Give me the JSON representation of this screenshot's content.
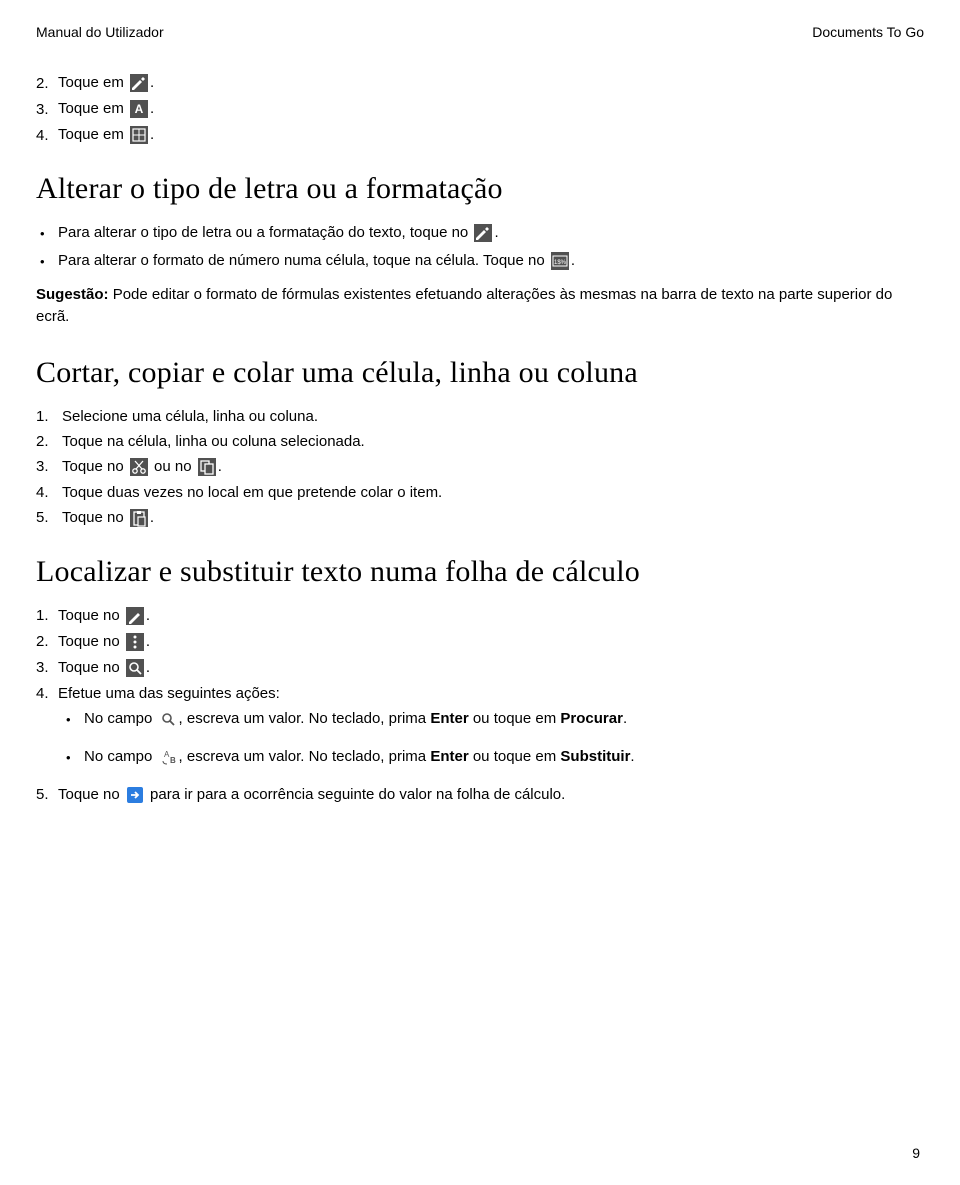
{
  "header": {
    "left": "Manual do Utilizador",
    "right": "Documents To Go"
  },
  "intro_list": [
    {
      "n": "2.",
      "pre": "Toque em ",
      "icon": "pen-icon",
      "post": "."
    },
    {
      "n": "3.",
      "pre": "Toque em ",
      "icon": "a-icon",
      "post": "."
    },
    {
      "n": "4.",
      "pre": "Toque em ",
      "icon": "grid-icon",
      "post": "."
    }
  ],
  "section1": {
    "title": "Alterar o tipo de letra ou a formatação",
    "bullets": [
      {
        "pre": "Para alterar o tipo de letra ou a formatação do texto, toque no ",
        "icon": "pen-icon",
        "post": "."
      },
      {
        "pre": "Para alterar o formato de número numa célula, toque na célula. Toque no ",
        "icon": "numfmt-icon",
        "post": "."
      }
    ],
    "suggestion_label": "Sugestão: ",
    "suggestion_text": "Pode editar o formato de fórmulas existentes efetuando alterações às mesmas na barra de texto na parte superior do ecrã."
  },
  "section2": {
    "title": "Cortar, copiar e colar uma célula, linha ou coluna",
    "items": [
      {
        "n": "1.",
        "full": "Selecione uma célula, linha ou coluna."
      },
      {
        "n": "2.",
        "full": "Toque na célula, linha ou coluna selecionada."
      },
      {
        "n": "3.",
        "pre": "Toque no ",
        "icon": "cut-icon",
        "mid": " ou no ",
        "icon2": "copy-icon",
        "post": "."
      },
      {
        "n": "4.",
        "full": "Toque duas vezes no local em que pretende colar o item."
      },
      {
        "n": "5.",
        "pre": "Toque no ",
        "icon": "paste-icon",
        "post": "."
      }
    ]
  },
  "section3": {
    "title": "Localizar e substituir texto numa folha de cálculo",
    "items": [
      {
        "n": "1.",
        "pre": "Toque no ",
        "icon": "pencil2-icon",
        "post": "."
      },
      {
        "n": "2.",
        "pre": "Toque no ",
        "icon": "more-icon",
        "post": "."
      },
      {
        "n": "3.",
        "pre": "Toque no ",
        "icon": "search-icon",
        "post": "."
      },
      {
        "n": "4.",
        "full": "Efetue uma das seguintes ações:"
      }
    ],
    "sub": [
      {
        "pre": "No campo ",
        "icon": "search-outline-icon",
        "mid1": ", escreva um valor. No teclado, prima ",
        "b1": "Enter",
        "mid2": " ou toque em ",
        "b2": "Procurar",
        "post": "."
      },
      {
        "pre": "No campo ",
        "icon": "replace-icon",
        "mid1": ", escreva um valor. No teclado, prima ",
        "b1": "Enter",
        "mid2": " ou toque em ",
        "b2": "Substituir",
        "post": "."
      }
    ],
    "item5": {
      "n": "5.",
      "pre": "Toque no ",
      "icon": "arrow-icon",
      "post": " para ir para a ocorrência seguinte do valor na folha de cálculo."
    }
  },
  "page": "9"
}
